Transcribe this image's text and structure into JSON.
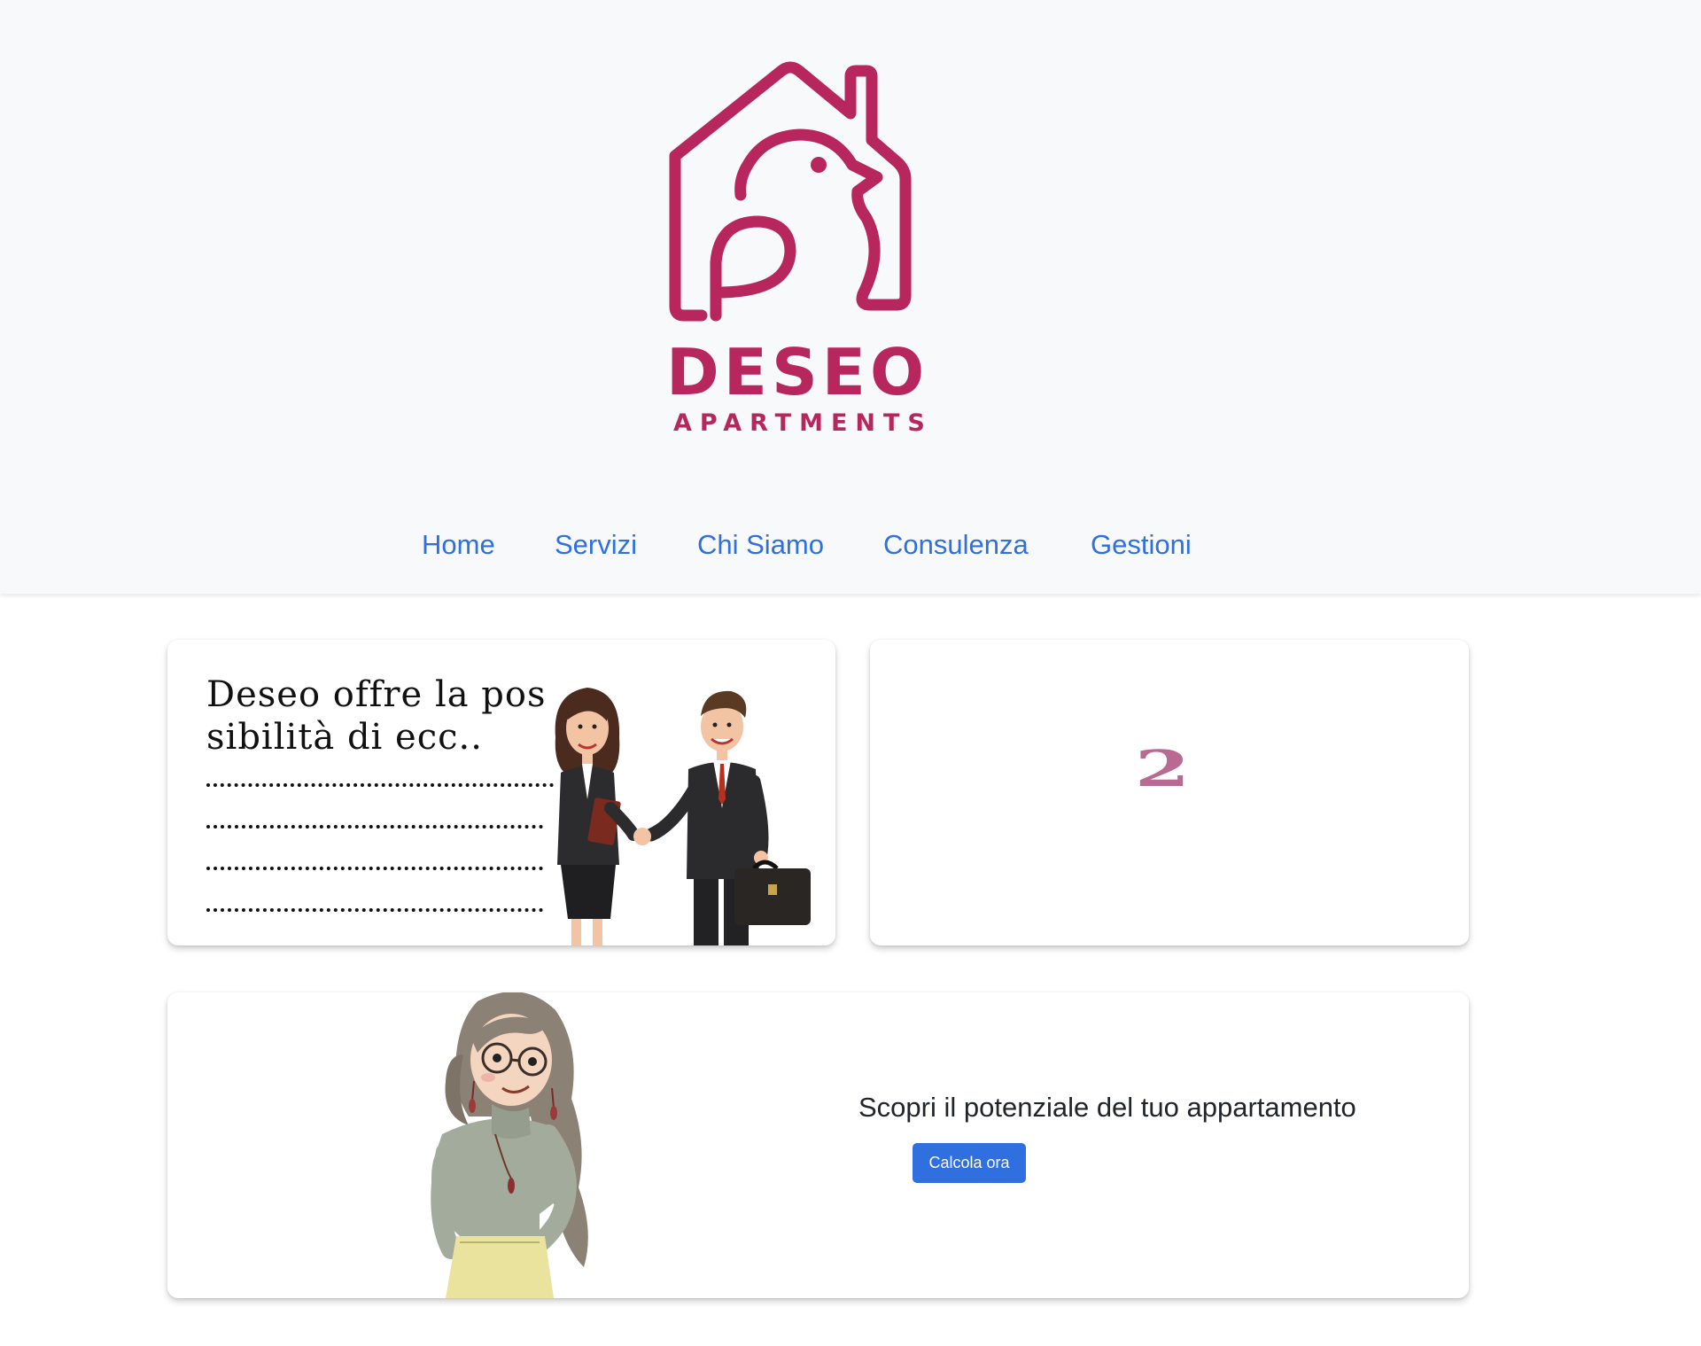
{
  "header": {
    "brand_name": "DESEO",
    "brand_sub": "APARTMENTS",
    "brand_color": "#b8265e"
  },
  "nav": {
    "items": [
      {
        "label": "Home"
      },
      {
        "label": "Servizi"
      },
      {
        "label": "Chi Siamo"
      },
      {
        "label": "Consulenza"
      },
      {
        "label": "Gestioni"
      }
    ],
    "link_color": "#2f6fe0"
  },
  "carousel": {
    "slide_1": {
      "text": "Deseo offre la possibilità di ecc..",
      "icon": "handshake-illustration"
    },
    "slide_2": {
      "number": "2"
    }
  },
  "cta": {
    "title": "Scopri il potenziale del tuo appartamento",
    "button_label": "Calcola ora",
    "button_color": "#2f6fe0",
    "icon": "woman-illustration"
  }
}
